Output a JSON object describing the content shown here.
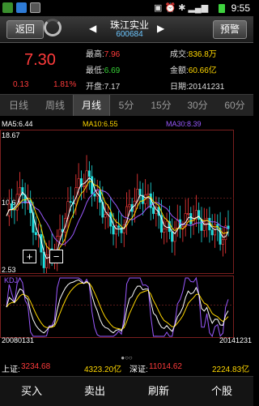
{
  "status_bar": {
    "time": "9:55"
  },
  "header": {
    "back_label": "返回",
    "stock_name": "珠江实业",
    "stock_code": "600684",
    "alert_label": "预警"
  },
  "quote": {
    "price": "7.30",
    "change": "0.13",
    "change_pct": "1.81%",
    "high_label": "最高:",
    "high": "7.96",
    "low_label": "最低:",
    "low": "6.69",
    "open_label": "开盘:",
    "open": "7.17",
    "volume_label": "成交:",
    "volume": "836.8万",
    "amount_label": "金额:",
    "amount": "60.66亿",
    "date_label": "日期:",
    "date": "20141231"
  },
  "tabs": [
    "日线",
    "周线",
    "月线",
    "5分",
    "15分",
    "30分",
    "60分"
  ],
  "active_tab": "月线",
  "chart_header": {
    "ma5": "MA5:6.44",
    "ma10": "MA10:6.55",
    "ma30": "MA30:8.39",
    "ymax": "18.67",
    "ymid": "10.60",
    "ymin": "2.53",
    "kdj": "KDJ",
    "start_date": "20080131",
    "end_date": "20141231"
  },
  "chart_controls": {
    "zoom_in": "+",
    "zoom_out": "−"
  },
  "chart_data": {
    "type": "line",
    "x_range": [
      "20080131",
      "20141231"
    ],
    "ylim": [
      2.53,
      18.67
    ],
    "series": [
      {
        "name": "MA5",
        "values": [
          6.44
        ]
      },
      {
        "name": "MA10",
        "values": [
          6.55
        ]
      },
      {
        "name": "MA30",
        "values": [
          8.39
        ]
      }
    ],
    "colors": {
      "ma5": "#ffffff",
      "ma10": "#ffd700",
      "ma30": "#9b59ff",
      "up": "#ff3b3b",
      "down": "#21e0e0"
    }
  },
  "page_indicator": "●○○",
  "index_bar": {
    "sh_label": "上证:",
    "sh_value": "3234.68",
    "sh_amount": "4323.20亿",
    "sz_label": "深证:",
    "sz_value": "11014.62",
    "sz_amount": "2224.83亿"
  },
  "bottom_nav": [
    "买入",
    "卖出",
    "刷新",
    "个股"
  ]
}
